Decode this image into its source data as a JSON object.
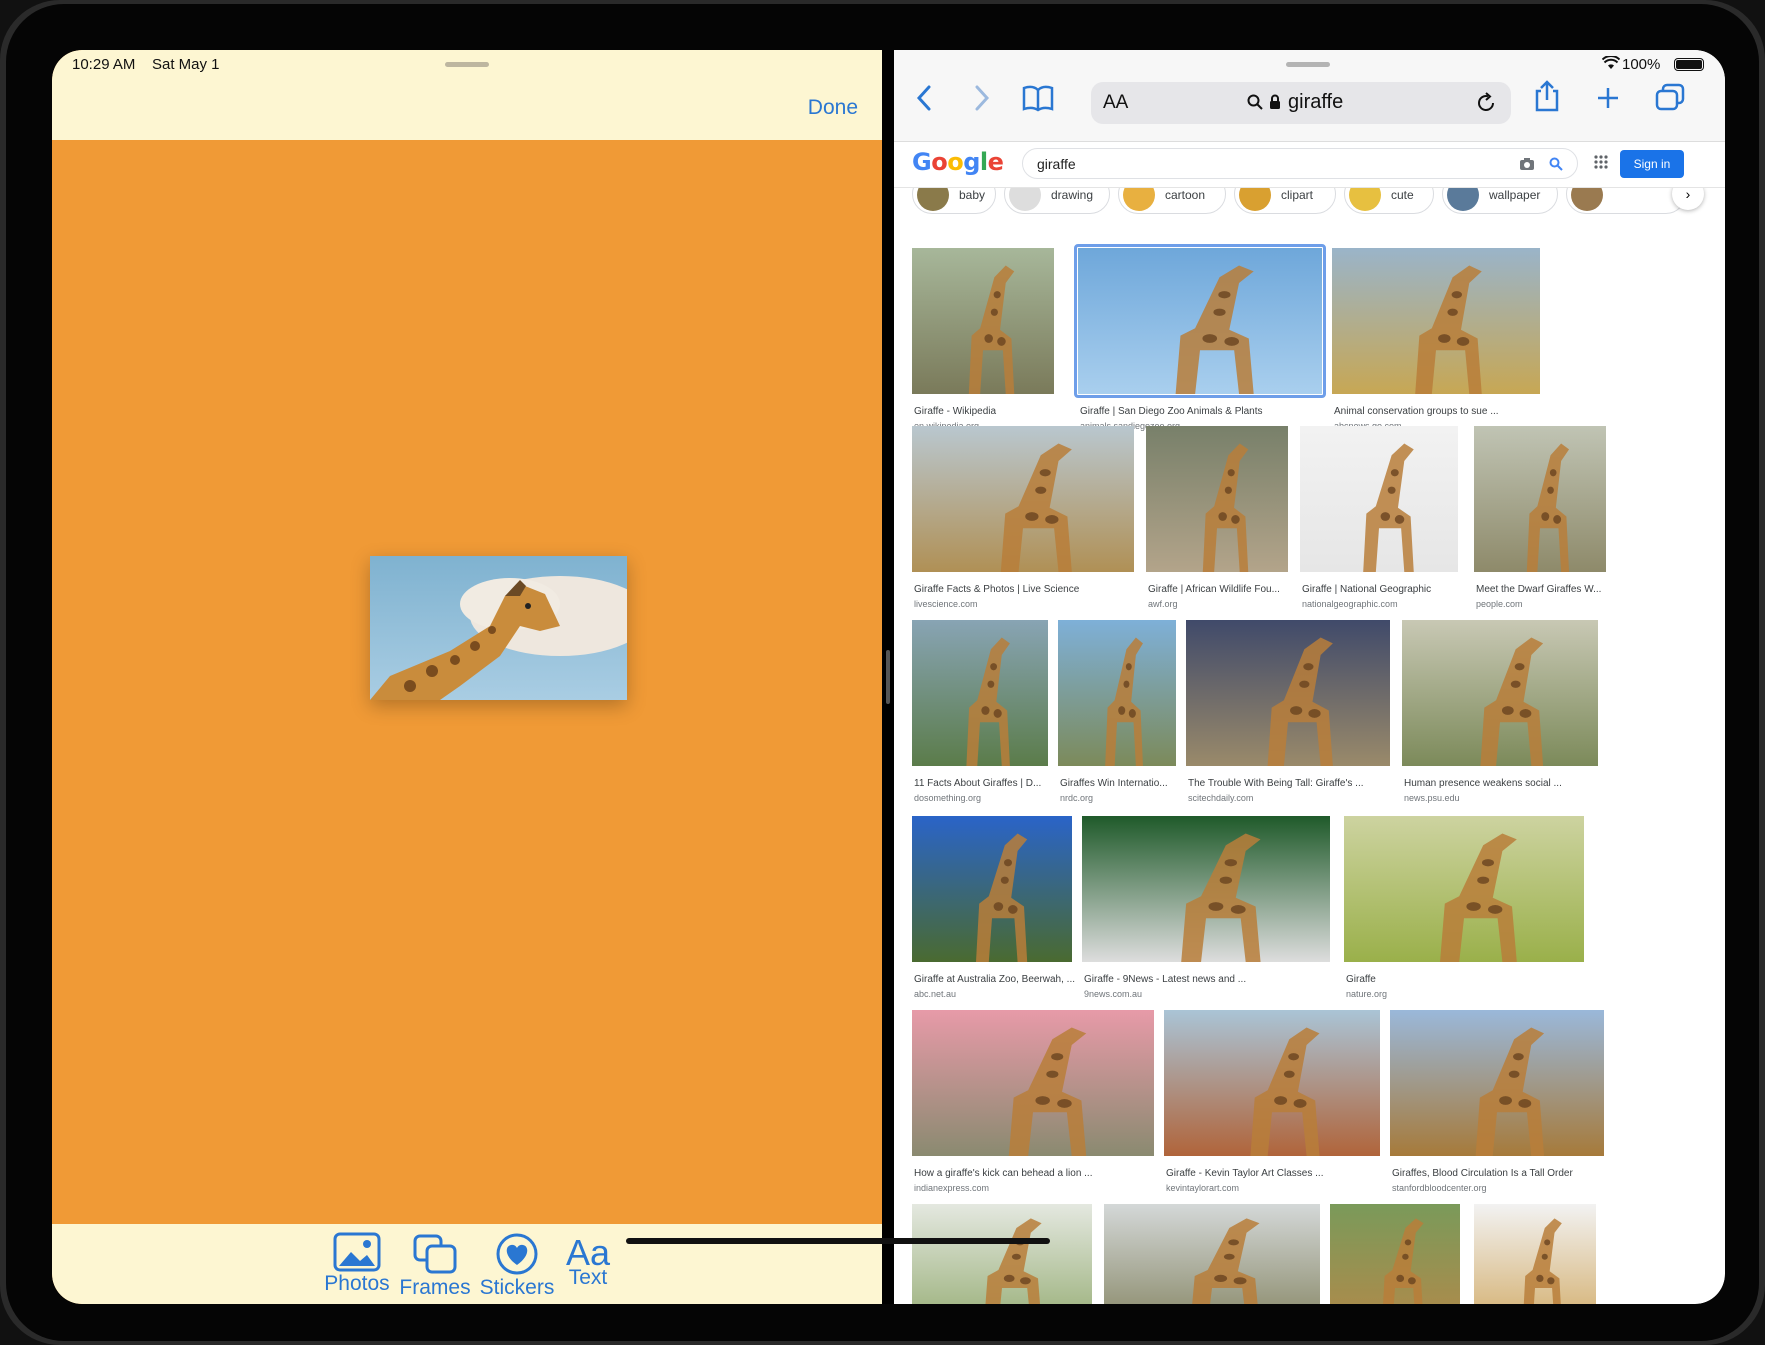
{
  "status": {
    "time": "10:29 AM",
    "date": "Sat May 1",
    "battery": "100%"
  },
  "left_app": {
    "done_label": "Done",
    "toolbar": [
      {
        "label": "Photos",
        "icon": "photo-icon"
      },
      {
        "label": "Frames",
        "icon": "frames-icon"
      },
      {
        "label": "Stickers",
        "icon": "heart-sticker-icon"
      },
      {
        "label": "Text",
        "icon": "text-icon"
      }
    ],
    "text_tool_glyph": "Aa",
    "background_color": "#f09a36"
  },
  "safari": {
    "aa_label": "AA",
    "url": "giraffe"
  },
  "google": {
    "logo": "Google",
    "query": "giraffe",
    "sign_in": "Sign in",
    "chips": [
      "baby",
      "drawing",
      "cartoon",
      "clipart",
      "cute",
      "wallpaper"
    ],
    "results": [
      {
        "title": "Giraffe - Wikipedia",
        "source": "en.wikipedia.org"
      },
      {
        "title": "Giraffe | San Diego Zoo Animals & Plants",
        "source": "animals.sandiegozoo.org"
      },
      {
        "title": "Animal conservation groups to sue ...",
        "source": "abcnews.go.com"
      },
      {
        "title": "Giraffe Facts & Photos | Live Science",
        "source": "livescience.com"
      },
      {
        "title": "Giraffe | African Wildlife Fou...",
        "source": "awf.org"
      },
      {
        "title": "Giraffe | National Geographic",
        "source": "nationalgeographic.com"
      },
      {
        "title": "Meet the Dwarf Giraffes W...",
        "source": "people.com"
      },
      {
        "title": "11 Facts About Giraffes | D...",
        "source": "dosomething.org"
      },
      {
        "title": "Giraffes Win Internatio...",
        "source": "nrdc.org"
      },
      {
        "title": "The Trouble With Being Tall: Giraffe's ...",
        "source": "scitechdaily.com"
      },
      {
        "title": "Human presence weakens social ...",
        "source": "news.psu.edu"
      },
      {
        "title": "Giraffe at Australia Zoo, Beerwah, ...",
        "source": "abc.net.au"
      },
      {
        "title": "Giraffe - 9News - Latest news and ...",
        "source": "9news.com.au"
      },
      {
        "title": "Giraffe",
        "source": "nature.org"
      },
      {
        "title": "How a giraffe's kick can behead a lion ...",
        "source": "indianexpress.com"
      },
      {
        "title": "Giraffe - Kevin Taylor Art Classes ...",
        "source": "kevintaylorart.com"
      },
      {
        "title": "Giraffes, Blood Circulation Is a Tall Order",
        "source": "stanfordbloodcenter.org"
      },
      {
        "title": "",
        "source": ""
      },
      {
        "title": "",
        "source": ""
      },
      {
        "title": "",
        "source": ""
      },
      {
        "title": "",
        "source": ""
      }
    ]
  },
  "colors": {
    "accent": "#2a77d2",
    "google_blue": "#1a73e8",
    "selection": "#6e9ee9"
  }
}
